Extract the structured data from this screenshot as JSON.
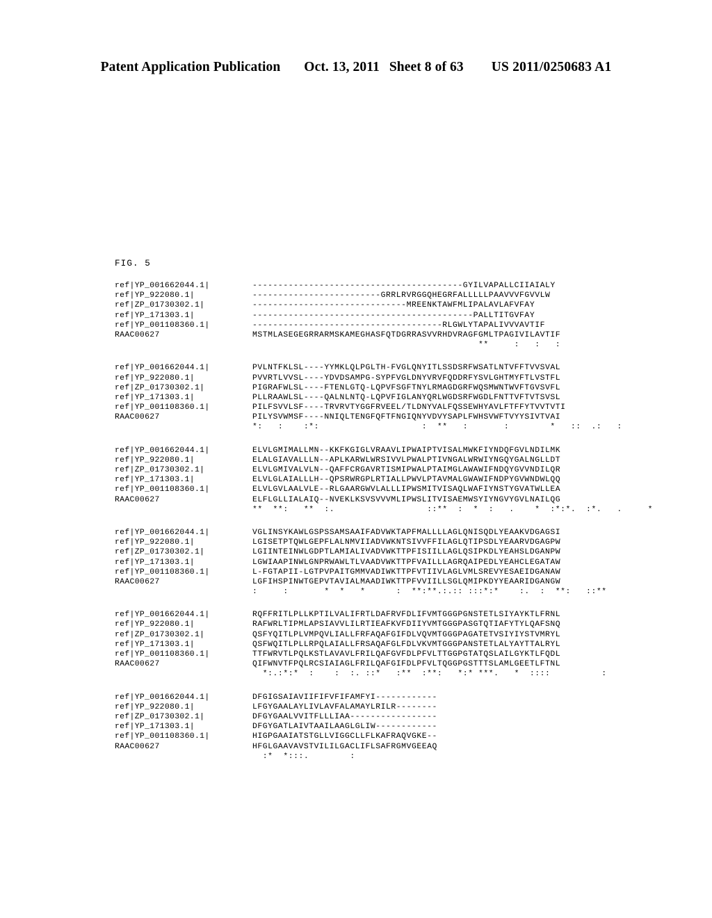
{
  "header": {
    "publication": "Patent Application Publication",
    "date": "Oct. 13, 2011",
    "sheet": "Sheet 8 of 63",
    "patent_number": "US 2011/0250683 A1"
  },
  "figure": {
    "label": "FIG. 5",
    "sequence_labels": [
      "ref|YP_001662044.1|",
      "ref|YP_922080.1|",
      "ref|ZP_01730302.1|",
      "ref|YP_171303.1|",
      "ref|YP_001108360.1|",
      "RAAC00627"
    ],
    "blocks": [
      {
        "sequences": [
          "-----------------------------------------GYILVAPALLCIIAIALY",
          "-------------------------GRRLRVRGGQHEGRFALLLLLPAAVVVFGVVLW",
          "------------------------------MREENKTAWFMLIPALAVLAFVFAY",
          "-------------------------------------------PALLTITGVFAY",
          "-------------------------------------RLGWLYTAPALIVVVAVTIF",
          "MSTMLASEGEGRRARMSKAMEGHASFQTDGRRASVVRHDVRAGFGMLTPAGIVILAVTIF"
        ],
        "conservation": "                                            **     :   :   :"
      },
      {
        "sequences": [
          "PVLNTFKLSL----YYMKLQLPGLTH-FVGLQNYITLSSDSRFWSATLNTVFFTVVSVAL",
          "PVVRTLVVSL----YDVDSAMPG-SYPFVGLDNYVRVFQDDRFYSVLGHTMYFTLVSTFL",
          "PIGRAFWLSL----FTENLGTQ-LQPVFSGFTNYLRMAGDGRFWQSMWNTWVFTGVSVFL",
          "PLLRAAWLSL----QALNLNTQ-LQPVFIGLANYQRLWGDSRFWGDLFNTTVFTVTSVSL",
          "PILFSVVLSF----TRVRVTYGGFRVEEL/TLDNYVALFQSSEWHYAVLFTFFYTVVTVTI",
          "PILYSVWMSF----NNIQLTENGFQFTFNGIQNYVDVYSAPLFWHSVWFTVYYSIVTVAI"
        ],
        "conservation": "*:   :    :*:                    :  **   :       :        *   ::  .:   :"
      },
      {
        "sequences": [
          "ELVLGMIMALLMN--KKFKGIGLVRAAVLIPWAIPTVISALMWKFIYNDQFGVLNDILMK",
          "ELALGIAVALLLN--APLKARWLWRSIVVLPWALPTIVNGALWRWIYNGQYGALNGLLDT",
          "ELVLGMIVALVLN--QAFFCRGAVRTISMIPWALPTAIMGLAWAWIFNDQYGVVNDILQR",
          "ELVLGLAIALLLH--QPSRWRGPLRTIALLPWVLPTAVMALGWAWIFNDPYGVWNDWLQQ",
          "ELVLGVLAALVLE--RLGAARGWVLALLLIPWSMITVISAQLWAFIYNSTYGVATWLLEA",
          "ELFLGLLIALAIQ--NVEKLKSVSVVVMLIPWSLITVISAEMWSYIYNGVYGVLNAILQG"
        ],
        "conservation": "**  **:   **  :.                  ::**  :  *  :   .    *  :*:*.  :*.   .     *"
      },
      {
        "sequences": [
          "VGLINSYKAWLGSPSSAMSAAIFADVWKTAPFMALLLLAGLQNISQDLYEAAKVDGAGSI",
          "LGISETPTQWLGEPFLALNMVIIADVWKNTSIVVFFILAGLQTIPSDLYEAARVDGAGPW",
          "LGIINTEINWLGDPTLAMIALIVADVWKTTPFISIILLAGLQSIPKDLYEAHSLDGANPW",
          "LGWIAAPINWLGNPRWAWLTLVAADVWKTTPFVAILLLAGRQAIPEDLYEAHCLEGATAW",
          "L-FGTAPII-LGTPVPAITGMMVADIWKTTPFVTIIVLAGLVMLSREVYESAEIDGANAW",
          "LGFIHSPINWTGEPVTAVIALMAADIWKTTPFVVIILLSGLQMIPKDYYEAARIDGANGW"
        ],
        "conservation": ":     :       *  *   *      :  **:**.:.:: :::*:*    :.  :  **:   ::**"
      },
      {
        "sequences": [
          "RQFFRITLPLLKPTILVALIFRTLDAFRVFDLIFVMTGGGPGNSTETLSIYAYKTLFRNL",
          "RAFWRLTIPMLAPSIAVVLILRTIEAFKVFDIIYVMTGGGPASGTQTIAFYTYLQAFSNQ",
          "QSFYQITLPLVMPQVLIALLFRFAQAFGIFDLVQVMTGGGPAGATETVSIYIYSTVMRYL",
          "QSFWQITLPLLRPQLAIALLFRSAQAFGLFDLVKVMTGGGPANSTETLALYAYTTALRYL",
          "TTFWRVTLPQLKSTLAVAVLFRILQAFGVFDLPFVLTTGGPGTATQSLAILGYKTLFQDL",
          "QIFWNVTFPQLRCSIAIAGLFRILQAFGIFDLPFVLTQGGPGSTTTSLAMLGEETLFTNL"
        ],
        "conservation": "  *:.:*:*  :    :  :. ::*   :**  :**:   *:* ***.   *  ::::          :"
      },
      {
        "sequences": [
          "DFGIGSAIAVIIFIFVFIFAMFYI------------",
          "LFGYGAALAYLIVLAVFALAMAYLRILR--------",
          "DFGYGAALVVITFLLLIAA-----------------",
          "DFGYGATLAIVTAAILAAGLGLIW------------",
          "HIGPGAAIATSTGLLVIGGCLLFLKAFRAQVGKE--",
          "HFGLGAAVAVSTVILILGACLIFLSAFRGMVGEEAQ"
        ],
        "conservation": "  :*  *:::.        :"
      }
    ]
  }
}
